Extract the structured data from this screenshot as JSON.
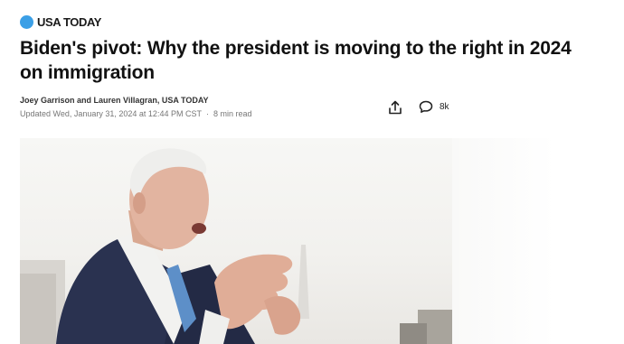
{
  "brand": {
    "logo_text": "USA TODAY",
    "accent": "#3b9fe6"
  },
  "article": {
    "headline": "Biden's pivot: Why the president is moving to the right in 2024 on immigration",
    "byline": "Joey Garrison and Lauren Villagran, USA TODAY",
    "updated": "Updated Wed, January 31, 2024 at 12:44 PM CST",
    "separator": "·",
    "read_time": "8 min read"
  },
  "actions": {
    "share_icon": "share-icon",
    "comment_icon": "comment-icon",
    "comment_count": "8k"
  },
  "hero_image": {
    "subject": "photo"
  }
}
